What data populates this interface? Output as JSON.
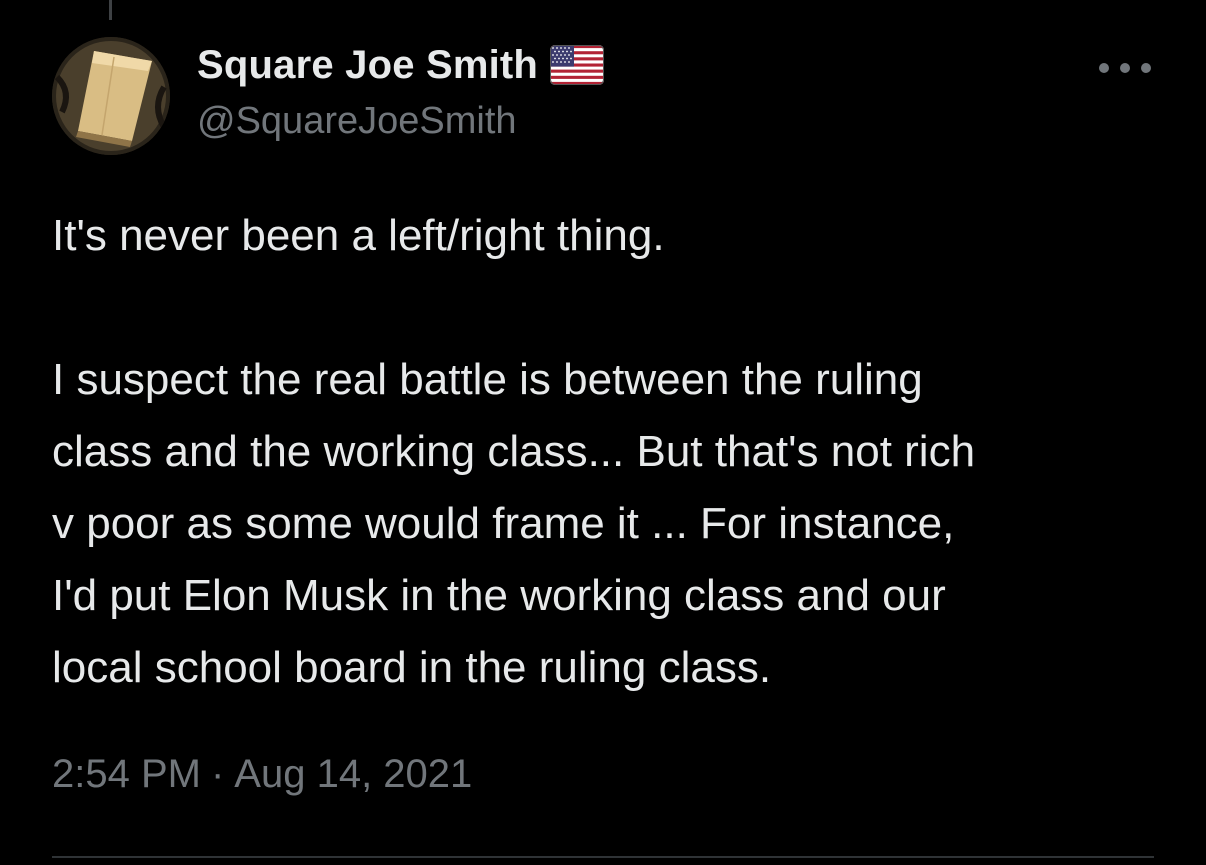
{
  "user": {
    "display_name": "Square Joe Smith",
    "handle": "@SquareJoeSmith",
    "flag_icon": "us-flag-icon"
  },
  "tweet": {
    "first_paragraph": "It's never been a left/right thing.",
    "second_paragraph_lines": [
      "I suspect the real battle is between the ruling",
      "class and the working class... But that's not rich",
      "v poor as some would frame it ... For instance,",
      "I'd put Elon Musk in the working class and our",
      "local school board in the ruling class."
    ],
    "time": "2:54 PM",
    "separator": "·",
    "date": "Aug 14, 2021"
  },
  "colors": {
    "background": "#000000",
    "primary_text": "#e7e9ea",
    "secondary_text": "#71767b",
    "divider": "#2f3336"
  }
}
